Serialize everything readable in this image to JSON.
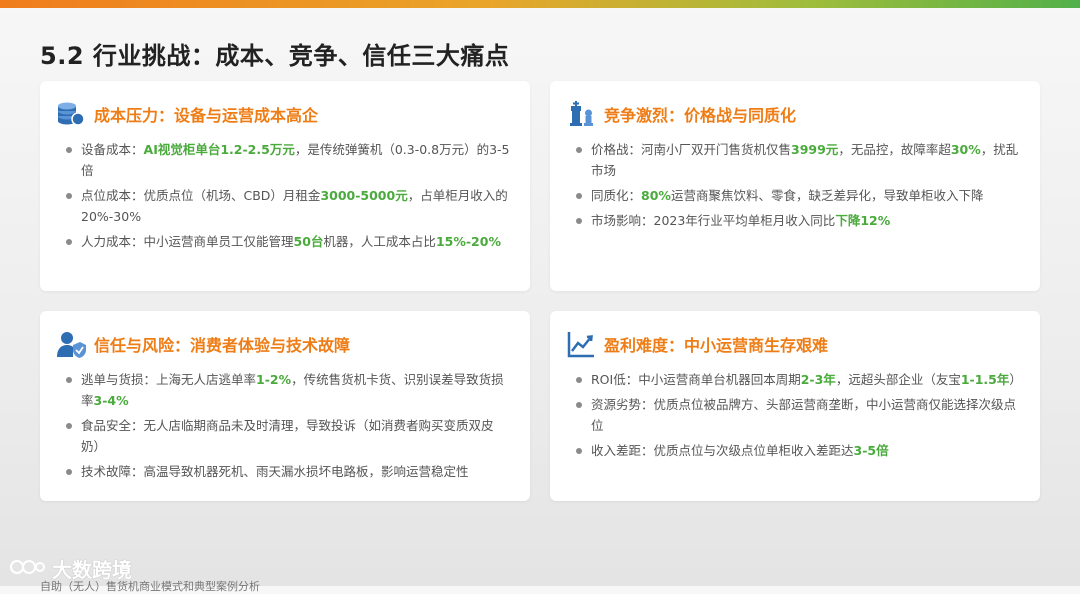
{
  "page": {
    "title": "5.2 行业挑战：成本、竞争、信任三大痛点",
    "footer_logo_text": "大数跨境",
    "footer_caption": "自助（无人）售货机商业模式和典型案例分析"
  },
  "colors": {
    "accent_orange": "#ef7d16",
    "highlight_green": "#4aaa3c",
    "icon_blue": "#2f6db3"
  },
  "cards": [
    {
      "icon": "coins-stack-icon",
      "title": "成本压力：设备与运营成本高企",
      "bullets": [
        [
          {
            "t": "设备成本：",
            "h": false
          },
          {
            "t": "AI视觉柜单台1.2-2.5万元",
            "h": true
          },
          {
            "t": "，是传统弹簧机（0.3-0.8万元）的3-5倍",
            "h": false
          }
        ],
        [
          {
            "t": "点位成本：优质点位（机场、CBD）月租金",
            "h": false
          },
          {
            "t": "3000-5000元",
            "h": true
          },
          {
            "t": "，占单柜月收入的20%-30%",
            "h": false
          }
        ],
        [
          {
            "t": "人力成本：中小运营商单员工仅能管理",
            "h": false
          },
          {
            "t": "50台",
            "h": true
          },
          {
            "t": "机器，人工成本占比",
            "h": false
          },
          {
            "t": "15%-20%",
            "h": true
          }
        ]
      ]
    },
    {
      "icon": "chess-pieces-icon",
      "title": "竞争激烈：价格战与同质化",
      "bullets": [
        [
          {
            "t": "价格战：河南小厂双开门售货机仅售",
            "h": false
          },
          {
            "t": "3999元",
            "h": true
          },
          {
            "t": "，无品控，故障率超",
            "h": false
          },
          {
            "t": "30%",
            "h": true
          },
          {
            "t": "，扰乱市场",
            "h": false
          }
        ],
        [
          {
            "t": "同质化：",
            "h": false
          },
          {
            "t": "80%",
            "h": true
          },
          {
            "t": "运营商聚焦饮料、零食，缺乏差异化，导致单柜收入下降",
            "h": false
          }
        ],
        [
          {
            "t": "市场影响：2023年行业平均单柜月收入同比",
            "h": false
          },
          {
            "t": "下降12%",
            "h": true
          }
        ]
      ]
    },
    {
      "icon": "user-shield-icon",
      "title": "信任与风险：消费者体验与技术故障",
      "bullets": [
        [
          {
            "t": "逃单与货损：上海无人店逃单率",
            "h": false
          },
          {
            "t": "1-2%",
            "h": true
          },
          {
            "t": "，传统售货机卡货、识别误差导致货损率",
            "h": false
          },
          {
            "t": "3-4%",
            "h": true
          }
        ],
        [
          {
            "t": "食品安全：无人店临期商品未及时清理，导致投诉（如消费者购买变质双皮奶）",
            "h": false
          }
        ],
        [
          {
            "t": "技术故障：高温导致机器死机、雨天漏水损坏电路板，影响运营稳定性",
            "h": false
          }
        ]
      ]
    },
    {
      "icon": "line-chart-icon",
      "title": "盈利难度：中小运营商生存艰难",
      "bullets": [
        [
          {
            "t": "ROI低：中小运营商单台机器回本周期",
            "h": false
          },
          {
            "t": "2-3年",
            "h": true
          },
          {
            "t": "，远超头部企业（友宝",
            "h": false
          },
          {
            "t": "1-1.5年",
            "h": true
          },
          {
            "t": "）",
            "h": false
          }
        ],
        [
          {
            "t": "资源劣势：优质点位被品牌方、头部运营商垄断，中小运营商仅能选择次级点位",
            "h": false
          }
        ],
        [
          {
            "t": "收入差距：优质点位与次级点位单柜收入差距达",
            "h": false
          },
          {
            "t": "3-5倍",
            "h": true
          }
        ]
      ]
    }
  ]
}
